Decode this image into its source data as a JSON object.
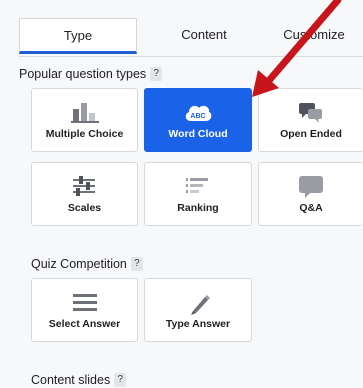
{
  "tabs": [
    {
      "label": "Type",
      "active": true
    },
    {
      "label": "Content",
      "active": false
    },
    {
      "label": "Customize",
      "active": false
    }
  ],
  "sections": {
    "popular": {
      "title": "Popular question types",
      "help": "?",
      "items": [
        {
          "label": "Multiple Choice",
          "icon": "bar-chart-icon",
          "selected": false
        },
        {
          "label": "Word Cloud",
          "icon": "word-cloud-icon",
          "icon_text": "ABC",
          "selected": true
        },
        {
          "label": "Open Ended",
          "icon": "speech-bubbles-icon",
          "selected": false
        },
        {
          "label": "Scales",
          "icon": "sliders-icon",
          "selected": false
        },
        {
          "label": "Ranking",
          "icon": "ranking-list-icon",
          "selected": false
        },
        {
          "label": "Q&A",
          "icon": "chat-bubble-icon",
          "selected": false
        }
      ]
    },
    "quiz": {
      "title": "Quiz Competition",
      "help": "?",
      "items": [
        {
          "label": "Select Answer",
          "icon": "list-lines-icon"
        },
        {
          "label": "Type Answer",
          "icon": "pencil-icon"
        }
      ]
    },
    "content": {
      "title": "Content slides",
      "help": "?"
    }
  },
  "colors": {
    "accent": "#1a63e8",
    "tab_underline": "#1f5fd1",
    "arrow": "#c8141b",
    "icon_gray": "#6e7179"
  }
}
